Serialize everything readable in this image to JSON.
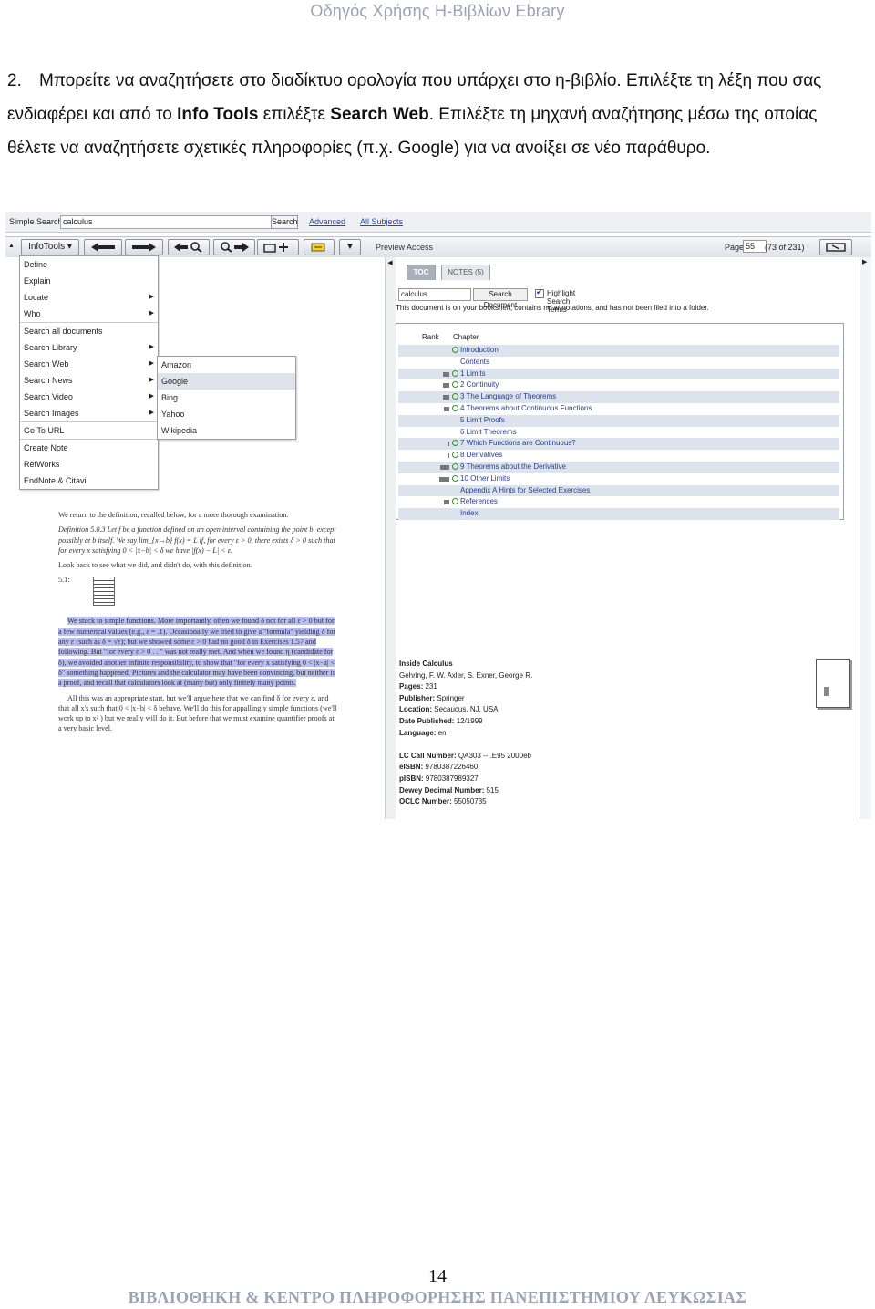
{
  "header": "Οδηγός Χρήσης Η-Βιβλίων Ebrary",
  "instruction": {
    "number": "2.",
    "part1": "Μπορείτε να αναζητήσετε στο διαδίκτυο ορολογία που υπάρχει στο η-βιβλίο. Επιλέξτε τη λέξη που σας ενδιαφέρει και από το ",
    "bold1": "Info Tools",
    "part2": " επιλέξτε ",
    "bold2": "Search Web",
    "part3": ". Επιλέξτε τη μηχανή αναζήτησης μέσω της οποίας θέλετε να αναζητήσετε σχετικές πληροφορίες (π.χ. Google) για να ανοίξει σε νέο παράθυρο."
  },
  "screenshot": {
    "simple_search_label": "Simple Search:",
    "simple_search_value": "calculus",
    "search_button": "Search",
    "advanced_link": "Advanced",
    "all_subjects_link": "All Subjects",
    "infotools_button": "InfoTools",
    "preview_access": "Preview Access",
    "page_label": "Page",
    "page_value": "55",
    "page_of": "(73 of 231)",
    "infotools_menu": [
      "Define",
      "Explain",
      "Locate",
      "Who",
      "Search all documents",
      "Search Library",
      "Search Web",
      "Search News",
      "Search Video",
      "Search Images",
      "Go To URL",
      "Create Note",
      "RefWorks",
      "EndNote & Citavi"
    ],
    "search_web_submenu": [
      "Amazon",
      "Google",
      "Bing",
      "Yahoo",
      "Wikipedia"
    ],
    "highlighted_submenu_item": "Google",
    "doc_text": {
      "intro": "We return to the definition, recalled below, for a more thorough examination.",
      "definition": "Definition 5.0.3  Let f be a function defined on an open interval containing the point b, except possibly at b itself. We say lim_{x→b} f(x) = L if, for every ε > 0, there exists δ > 0 such that for every x satisfying 0 < |x−b| < δ we have |f(x) − L| < ε.",
      "look_back": "Look back to see what we did, and didn't do, with this definition.",
      "label_51": "5.1:",
      "highlighted": "We stuck to simple functions. More importantly, often we found δ not for all ε > 0 but for a few numerical values (e.g., ε = .1). Occasionally we tried to give a \"formula\" yielding δ for any ε (such as δ = √ε); but we showed some ε > 0 had no good δ in Exercises 1.57 and following. But \"for every ε > 0 . . \" was not really met. And when we found η (candidate for δ), we avoided another infinite responsibility, to show that \"for every x satisfying 0 < |x−a| < δ\" something happened. Pictures and the calculator may have been convincing, but neither is a proof, and recall that calculators look at (many but) only finitely many points.",
      "after": "All this was an appropriate start, but we'll argue here that we can find δ for every ε, and that all x's such that 0 < |x−b| < δ behave. We'll do this for appallingly simple functions (we'll work up to x² ) but we really will do it. But before that we must examine quantifier proofs at a very basic level."
    },
    "tabs": [
      "TOC",
      "NOTES (5)"
    ],
    "toc_search_value": "calculus",
    "toc_search_button": "Search Document",
    "highlight_label": "Highlight Search Terms",
    "toc_note": "This document is on your bookshelf, contains no annotations, and has not been filed into a folder.",
    "toc_headers": [
      "Rank",
      "Chapter"
    ],
    "toc_rows": [
      {
        "rank": 0.0,
        "mag": true,
        "title": "Introduction"
      },
      {
        "rank": 0.0,
        "mag": false,
        "title": "Contents"
      },
      {
        "rank": 0.5,
        "mag": true,
        "title": "1 Limits"
      },
      {
        "rank": 0.5,
        "mag": true,
        "title": "2 Continuity"
      },
      {
        "rank": 0.5,
        "mag": true,
        "title": "3 The Language of Theorems"
      },
      {
        "rank": 0.45,
        "mag": true,
        "title": "4 Theorems about Continuous Functions"
      },
      {
        "rank": 0.0,
        "mag": false,
        "title": "5 Limit Proofs"
      },
      {
        "rank": 0.0,
        "mag": false,
        "title": "6 Limit Theorems"
      },
      {
        "rank": 0.1,
        "mag": true,
        "title": "7 Which Functions are Continuous?"
      },
      {
        "rank": 0.1,
        "mag": true,
        "title": "8 Derivatives"
      },
      {
        "rank": 0.7,
        "mag": true,
        "title": "9 Theorems about the Derivative"
      },
      {
        "rank": 0.8,
        "mag": true,
        "title": "10 Other Limits"
      },
      {
        "rank": 0.0,
        "mag": false,
        "title": "Appendix A Hints for Selected Exercises"
      },
      {
        "rank": 0.45,
        "mag": true,
        "title": "References"
      },
      {
        "rank": 0.0,
        "mag": false,
        "title": "Index"
      }
    ],
    "book_info": [
      {
        "label": "",
        "value": "Inside Calculus"
      },
      {
        "label": "",
        "value": "Gehring, F. W. Axler, S. Exner, George R."
      },
      {
        "label": "Pages:",
        "value": "231"
      },
      {
        "label": "Publisher:",
        "value": "Springer"
      },
      {
        "label": "Location:",
        "value": "Secaucus, NJ, USA"
      },
      {
        "label": "Date Published:",
        "value": "12/1999"
      },
      {
        "label": "Language:",
        "value": "en"
      },
      {
        "label": "",
        "value": ""
      },
      {
        "label": "LC Call Number:",
        "value": "QA303 -- .E95 2000eb"
      },
      {
        "label": "eISBN:",
        "value": "9780387226460"
      },
      {
        "label": "pISBN:",
        "value": "9780387989327"
      },
      {
        "label": "Dewey Decimal Number:",
        "value": "515"
      },
      {
        "label": "OCLC Number:",
        "value": "55050735"
      }
    ]
  },
  "page_number": "14",
  "footer": "ΒΙΒΛΙΟΘΗΚΗ & ΚΕΝΤΡΟ ΠΛΗΡΟΦΟΡΗΣΗΣ ΠΑΝΕΠΙΣΤΗΜΙΟΥ ΛΕΥΚΩΣΙΑΣ"
}
